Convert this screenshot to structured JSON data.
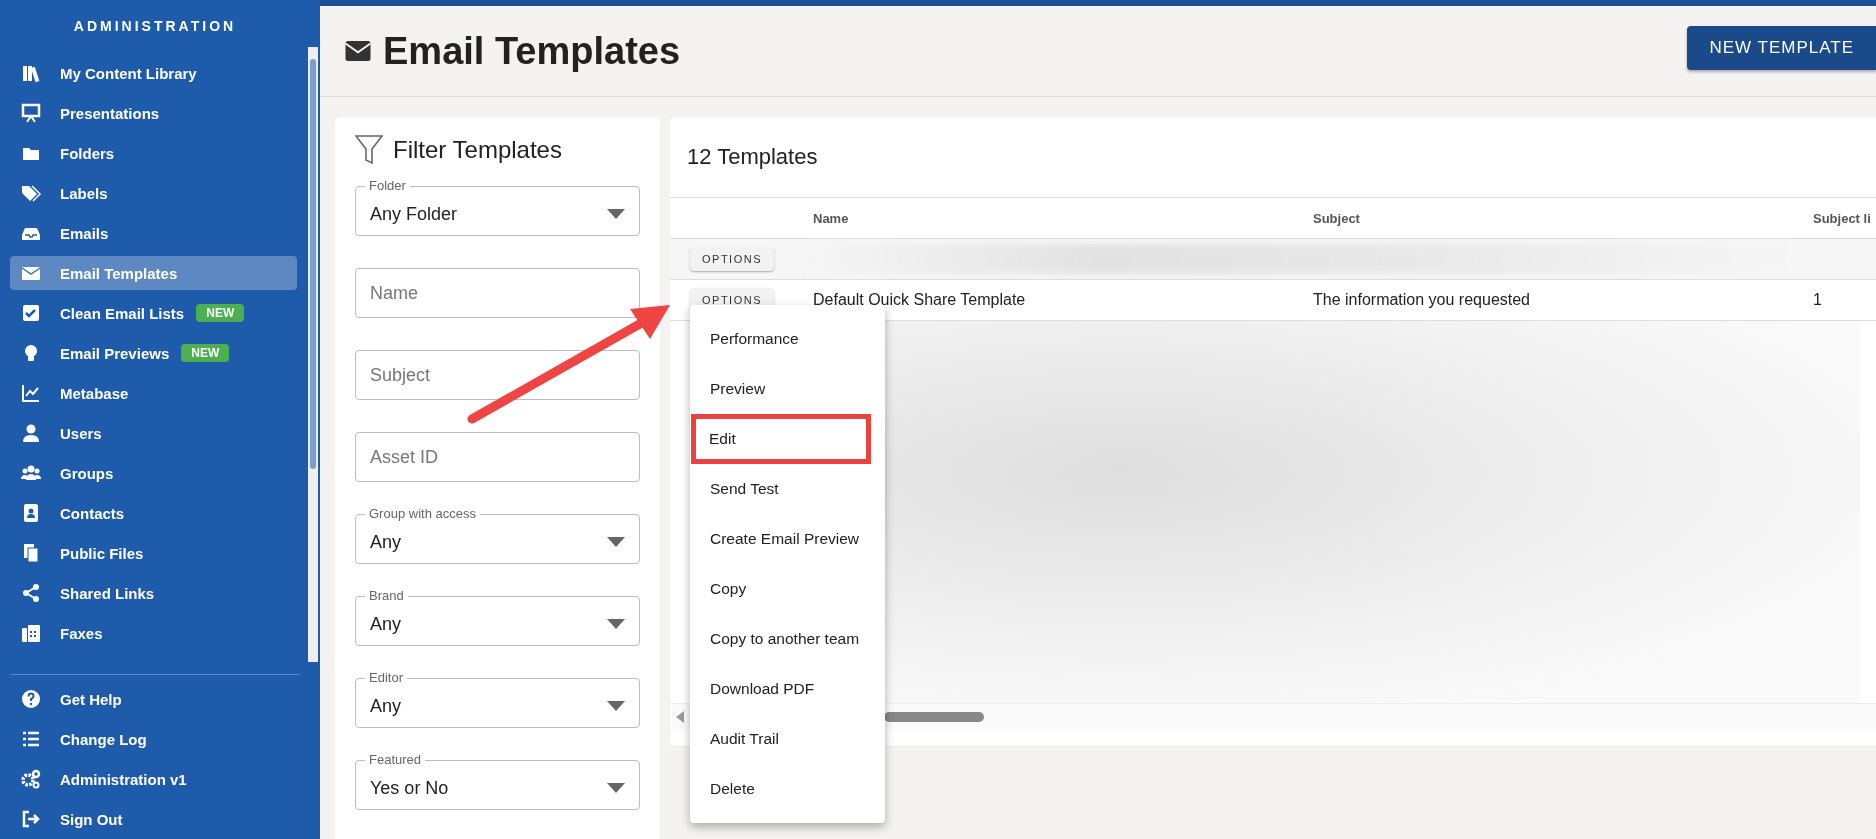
{
  "sidebar": {
    "title": "ADMINISTRATION",
    "items": [
      {
        "label": "My Content Library",
        "selected": false
      },
      {
        "label": "Presentations",
        "selected": false
      },
      {
        "label": "Folders",
        "selected": false
      },
      {
        "label": "Labels",
        "selected": false
      },
      {
        "label": "Emails",
        "selected": false
      },
      {
        "label": "Email Templates",
        "selected": true
      },
      {
        "label": "Clean Email Lists",
        "selected": false,
        "badge": "NEW"
      },
      {
        "label": "Email Previews",
        "selected": false,
        "badge": "NEW"
      },
      {
        "label": "Metabase",
        "selected": false
      },
      {
        "label": "Users",
        "selected": false
      },
      {
        "label": "Groups",
        "selected": false
      },
      {
        "label": "Contacts",
        "selected": false
      },
      {
        "label": "Public Files",
        "selected": false
      },
      {
        "label": "Shared Links",
        "selected": false
      },
      {
        "label": "Faxes",
        "selected": false
      }
    ],
    "footer_items": [
      {
        "label": "Get Help"
      },
      {
        "label": "Change Log"
      },
      {
        "label": "Administration v1"
      },
      {
        "label": "Sign Out"
      }
    ]
  },
  "header": {
    "title": "Email Templates",
    "button": "NEW TEMPLATE"
  },
  "filter": {
    "title": "Filter Templates",
    "fields": [
      {
        "kind": "select",
        "label": "Folder",
        "value": "Any Folder"
      },
      {
        "kind": "text",
        "placeholder": "Name"
      },
      {
        "kind": "text",
        "placeholder": "Subject"
      },
      {
        "kind": "text",
        "placeholder": "Asset ID"
      },
      {
        "kind": "select",
        "label": "Group with access",
        "value": "Any"
      },
      {
        "kind": "select",
        "label": "Brand",
        "value": "Any"
      },
      {
        "kind": "select",
        "label": "Editor",
        "value": "Any"
      },
      {
        "kind": "select",
        "label": "Featured",
        "value": "Yes or No"
      }
    ]
  },
  "table": {
    "title": "12 Templates",
    "columns": [
      "Name",
      "Subject",
      "Subject li"
    ],
    "rows": [
      {
        "options": "OPTIONS",
        "redacted": true,
        "cells": []
      },
      {
        "options": "OPTIONS",
        "redacted": false,
        "cells": [
          "Default Quick Share Template",
          "The information you requested",
          "1"
        ]
      }
    ]
  },
  "menu": {
    "items": [
      {
        "label": "Performance",
        "highlighted": false
      },
      {
        "label": "Preview",
        "highlighted": false
      },
      {
        "label": "Edit",
        "highlighted": true
      },
      {
        "label": "Send Test",
        "highlighted": false
      },
      {
        "label": "Create Email Preview",
        "highlighted": false
      },
      {
        "label": "Copy",
        "highlighted": false
      },
      {
        "label": "Copy to another team",
        "highlighted": false
      },
      {
        "label": "Download PDF",
        "highlighted": false
      },
      {
        "label": "Audit Trail",
        "highlighted": false
      },
      {
        "label": "Delete",
        "highlighted": false
      }
    ]
  }
}
